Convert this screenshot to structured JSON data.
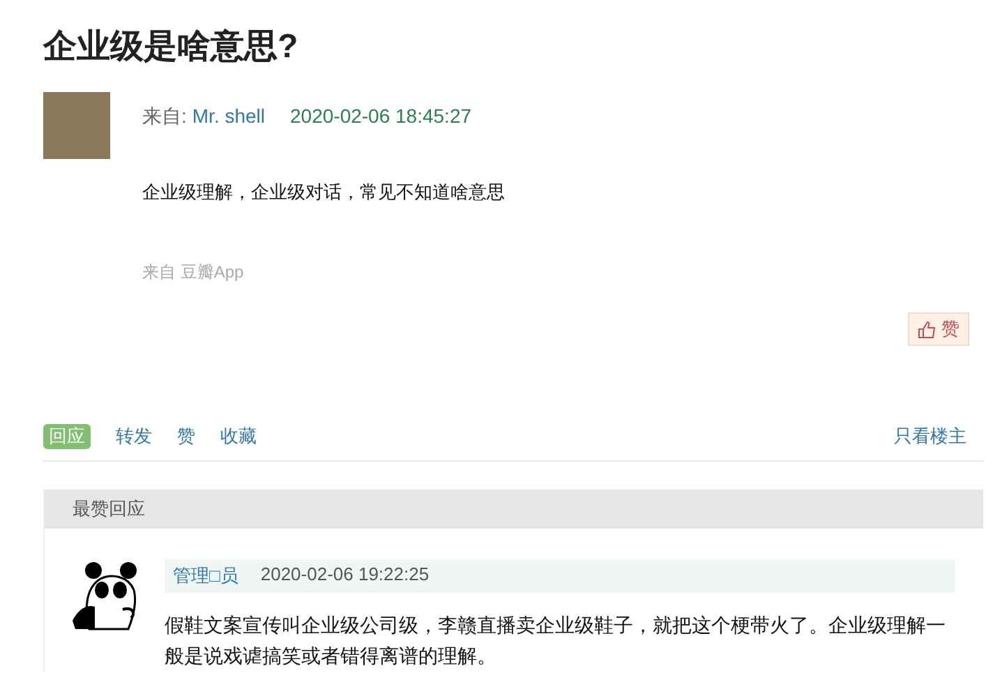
{
  "title": "企业级是啥意思?",
  "post": {
    "from_label": "来自:",
    "author": "Mr. shell",
    "time": "2020-02-06 18:45:27",
    "body": "企业级理解，企业级对话，常见不知道啥意思",
    "source": "来自 豆瓣App",
    "like_button": "赞"
  },
  "actions": [
    {
      "label": "回应",
      "selected": true
    },
    {
      "label": "转发",
      "selected": false
    },
    {
      "label": "赞",
      "selected": false
    },
    {
      "label": "收藏",
      "selected": false
    }
  ],
  "filter_link": "只看楼主",
  "best_replies": {
    "header": "最赞回应",
    "replies": [
      {
        "author": "管理□员",
        "time": "2020-02-06 19:22:25",
        "text": "假鞋文案宣传叫企业级公司级，李赣直播卖企业级鞋子，就把这个梗带火了。企业级理解一般是说戏谑搞笑或者错得离谱的理解。"
      }
    ]
  }
}
